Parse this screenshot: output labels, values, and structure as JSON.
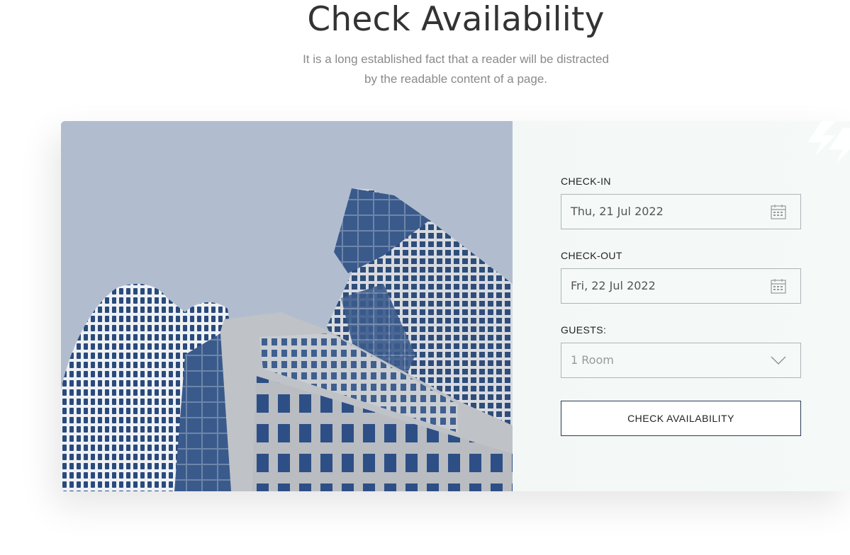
{
  "header": {
    "title": "Check Availability",
    "subtitle_line1": "It is a long established fact that a reader will be distracted",
    "subtitle_line2": "by the readable content of a page."
  },
  "form": {
    "check_in": {
      "label": "CHECK-IN",
      "value": "Thu, 21 Jul 2022",
      "icon": "calendar-icon"
    },
    "check_out": {
      "label": "CHECK-OUT",
      "value": "Fri, 22 Jul 2022",
      "icon": "calendar-icon"
    },
    "guests": {
      "label": "GUESTS:",
      "value": "1 Room",
      "icon": "chevron-down-icon"
    },
    "submit_label": "CHECK AVAILABILITY"
  },
  "colors": {
    "panel_bg": "#f5faf8",
    "button_border": "#2b3a55",
    "sky": "#b1bdcf"
  }
}
